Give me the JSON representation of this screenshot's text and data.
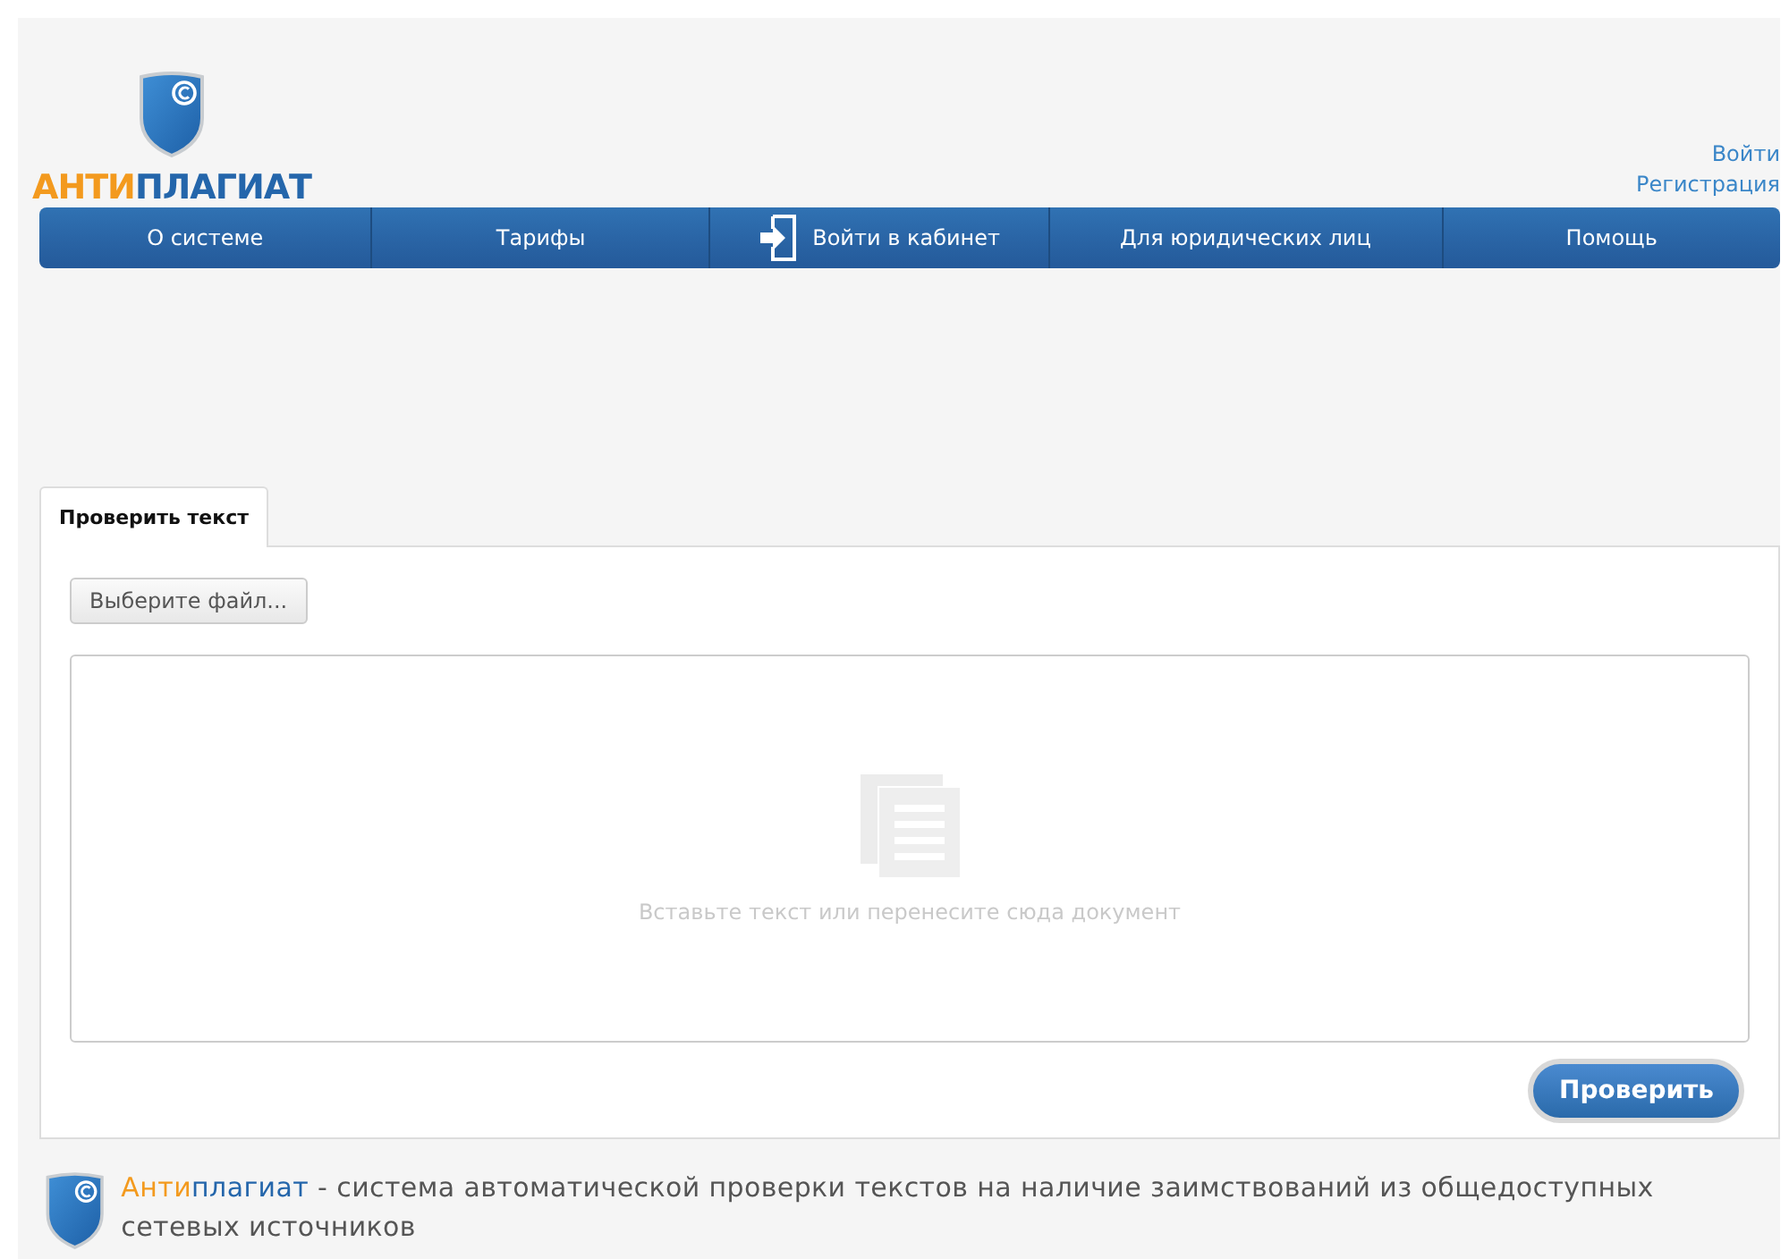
{
  "logo": {
    "part_1": "АНТИ",
    "part_2": "ПЛАГИАТ"
  },
  "account_links": [
    "Войти",
    "Регистрация"
  ],
  "nav": [
    {
      "label": "О системе",
      "kind": "text"
    },
    {
      "label": "Тарифы",
      "kind": "text"
    },
    {
      "label": "Войти в кабинет",
      "kind": "login"
    },
    {
      "label": "Для юридических лиц",
      "kind": "text"
    },
    {
      "label": "Помощь",
      "kind": "text"
    }
  ],
  "tabs": [
    {
      "label": "Проверить текст",
      "selected": true
    }
  ],
  "file_button": "Выберите файл...",
  "text_area": {
    "placeholder": "Вставьте текст или перенесите сюда документ"
  },
  "submit_button": "Проверить",
  "footer": {
    "brand_1": "Анти",
    "brand_2": "плагиат",
    "text": " - система автоматической проверки текстов на наличие заимствований из общедоступных сетевых источников"
  }
}
